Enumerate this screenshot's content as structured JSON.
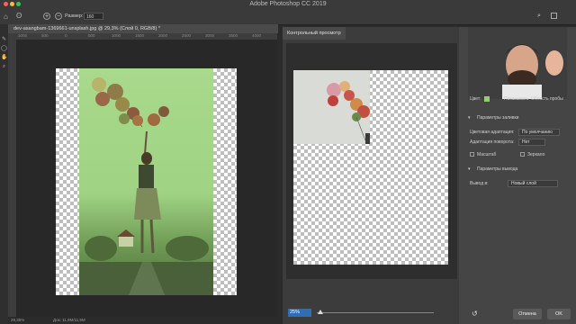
{
  "app": {
    "title": "Adobe Photoshop CC 2019"
  },
  "options_bar": {
    "size_label": "Размер:",
    "size_value": "160"
  },
  "document": {
    "tab_title": "dev-asangbam-1369661-unsplash.jpg @ 29,3% (Слой 0, RGB/8) *"
  },
  "rulers": {
    "h_ticks": [
      "1000",
      "500",
      "0",
      "500",
      "1000",
      "1500",
      "2000",
      "2500",
      "3000",
      "3500",
      "4000"
    ]
  },
  "status": {
    "zoom": "29,35%",
    "doc_info": "Док: 11,9M/11,9M"
  },
  "preview": {
    "tab_label": "Контрольный просмотр",
    "zoom_value": "25%"
  },
  "right_panel": {
    "header_fragment": {
      "color_label": "Цвет:",
      "show_label": "Показывать",
      "sample_label": "Область пробы"
    },
    "fill_settings": {
      "section_title": "Параметры заливки",
      "color_adapt_label": "Цветовая адаптация:",
      "color_adapt_value": "По умолчанию",
      "rotate_adapt_label": "Адаптация поворота:",
      "rotate_adapt_value": "Нет",
      "scale_label": "Масштаб",
      "mirror_label": "Зеркало"
    },
    "output_settings": {
      "section_title": "Параметры вывода",
      "output_label": "Вывод в:",
      "output_value": "Новый слой"
    },
    "buttons": {
      "cancel": "Отмена",
      "ok": "OK"
    }
  },
  "colors": {
    "sample_overlay": "#8fcf6e",
    "panel_bg": "#3c3c3c",
    "checker_dark": "#bdbdbd",
    "accent_zoom": "#2f6db5"
  }
}
